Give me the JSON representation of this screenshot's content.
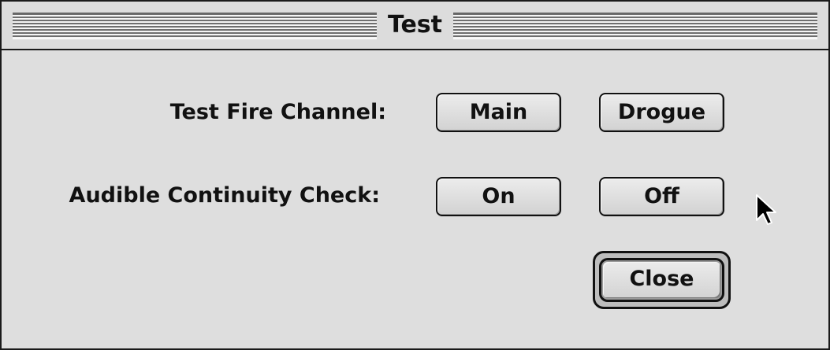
{
  "window": {
    "title": "Test"
  },
  "rows": [
    {
      "label": "Test Fire Channel:",
      "buttons": [
        "Main",
        "Drogue"
      ]
    },
    {
      "label": "Audible Continuity Check:",
      "buttons": [
        "On",
        "Off"
      ]
    }
  ],
  "footer": {
    "close_label": "Close"
  },
  "icons": {
    "cursor": "arrow-cursor-icon"
  }
}
